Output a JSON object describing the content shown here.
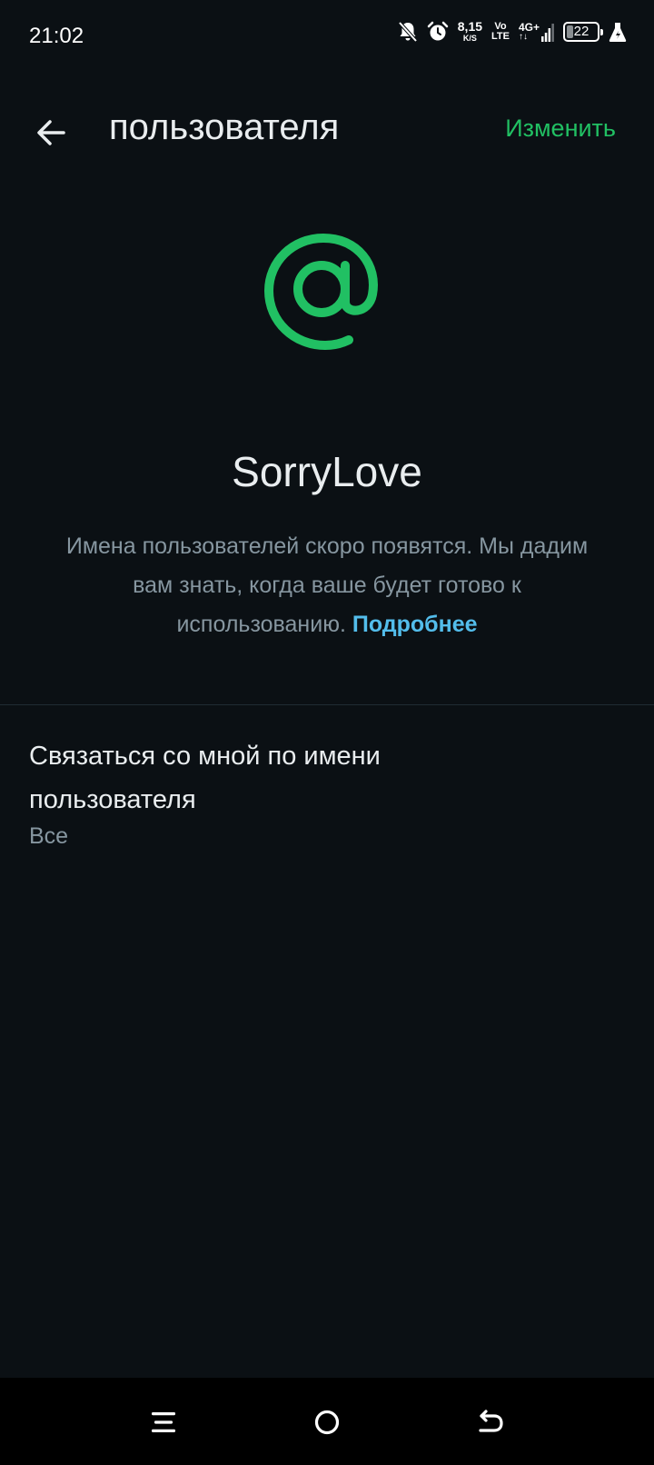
{
  "status_bar": {
    "time": "21:02",
    "net_speed_value": "8,15",
    "net_speed_unit": "K/S",
    "volte_top": "Vo",
    "volte_bottom": "LTE",
    "network_type": "4G+",
    "battery_level": "22",
    "battery_percent": 22,
    "icons": [
      "bell-off-icon",
      "alarm-icon",
      "signal-icon",
      "battery-icon",
      "flask-icon"
    ]
  },
  "app_bar": {
    "back_icon": "arrow-left-icon",
    "title": "пользователя",
    "edit_label": "Изменить"
  },
  "profile": {
    "icon": "at-sign-icon",
    "username": "SorryLove",
    "info_text": "Имена пользователей скоро появятся. Мы дадим вам знать, когда ваше будет готово к использованию.",
    "learn_more_label": "Подробнее"
  },
  "settings": {
    "contact_title": "Связаться со мной по имени пользователя",
    "contact_value": "Все"
  },
  "nav_bar": {
    "icons": [
      "menu-icon",
      "home-circle-icon",
      "back-arrow-icon"
    ]
  },
  "colors": {
    "background": "#0b1014",
    "accent": "#21c063",
    "link": "#53bdeb",
    "secondary_text": "#8696a0",
    "primary_text": "#e9edef"
  }
}
